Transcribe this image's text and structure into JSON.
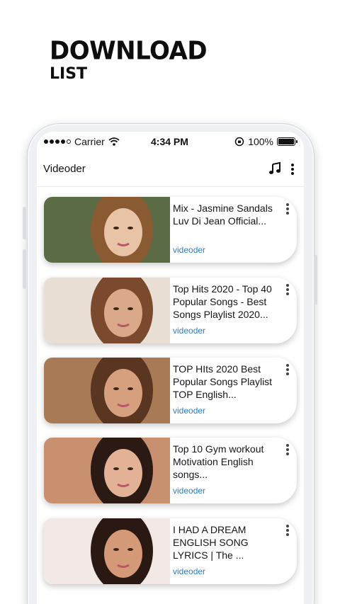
{
  "promo": {
    "headline_line1": "DOWNLOAD",
    "headline_line2": "LIST"
  },
  "status_bar": {
    "carrier": "Carrier",
    "time": "4:34 PM",
    "battery": "100%",
    "battery_level": 1.0
  },
  "app_bar": {
    "title": "Videoder",
    "icons": [
      "music-note-icon",
      "more-vertical-icon"
    ]
  },
  "videos": [
    {
      "title": "Mix - Jasmine Sandals Luv Di Jean Official...",
      "channel": "videoder",
      "thumb_bg": "#5b6b45",
      "hair": "#8a5a32",
      "skin": "#e8c3a6"
    },
    {
      "title": "Top Hits 2020 - Top 40 Popular Songs - Best Songs Playlist 2020...",
      "channel": "videoder",
      "thumb_bg": "#eadfd5",
      "hair": "#7b4a2e",
      "skin": "#d9a98a"
    },
    {
      "title": "TOP HIts 2020 Best Popular Songs Playlist TOP English...",
      "channel": "videoder",
      "thumb_bg": "#a87a55",
      "hair": "#5a3520",
      "skin": "#d6a07e"
    },
    {
      "title": "Top 10 Gym workout Motivation English songs...",
      "channel": "videoder",
      "thumb_bg": "#c99070",
      "hair": "#2b1a14",
      "skin": "#e3b195"
    },
    {
      "title": "I HAD A DREAM ENGLISH SONG LYRICS | The ...",
      "channel": "videoder",
      "thumb_bg": "#f2e8e6",
      "hair": "#2a1812",
      "skin": "#d49a78"
    }
  ]
}
